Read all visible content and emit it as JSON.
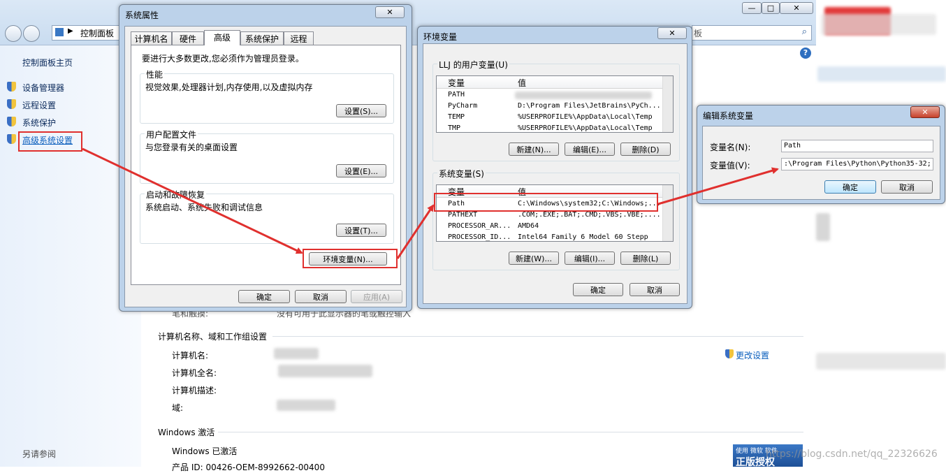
{
  "control_panel": {
    "breadcrumb": "控制面板",
    "breadcrumb_right": "板",
    "sidebar": {
      "home": "控制面板主页",
      "items": [
        "设备管理器",
        "远程设置",
        "系统保护",
        "高级系统设置"
      ],
      "see_also": "另请参阅"
    },
    "pen_touch_label": "笔和触摸:",
    "pen_touch_value": "没有可用于此显示器的笔或触控输入",
    "computer_section": "计算机名称、域和工作组设置",
    "rows": [
      "计算机名:",
      "计算机全名:",
      "计算机描述:",
      "域:"
    ],
    "change_settings": "更改设置",
    "windows_section": "Windows 激活",
    "activated": "Windows 已激活",
    "product_id": "产品 ID: 00426-OEM-8992662-00400",
    "badge_top": "使用 微软 软件",
    "badge_main": "正版授权",
    "watermark": "https://blog.csdn.net/qq_22326626"
  },
  "sys_props": {
    "title": "系统属性",
    "tabs": [
      "计算机名",
      "硬件",
      "高级",
      "系统保护",
      "远程"
    ],
    "admin_note": "要进行大多数更改,您必须作为管理员登录。",
    "perf_label": "性能",
    "perf_desc": "视觉效果,处理器计划,内存使用,以及虚拟内存",
    "perf_btn": "设置(S)...",
    "profile_label": "用户配置文件",
    "profile_desc": "与您登录有关的桌面设置",
    "profile_btn": "设置(E)...",
    "startup_label": "启动和故障恢复",
    "startup_desc": "系统启动、系统失败和调试信息",
    "startup_btn": "设置(T)...",
    "env_btn": "环境变量(N)...",
    "ok": "确定",
    "cancel": "取消",
    "apply": "应用(A)"
  },
  "env_vars": {
    "title": "环境变量",
    "user_group": "LLJ 的用户变量(U)",
    "col_var": "变量",
    "col_val": "值",
    "user_rows": [
      {
        "name": "PATH",
        "value": ""
      },
      {
        "name": "PyCharm",
        "value": "D:\\Program Files\\JetBrains\\PyCh..."
      },
      {
        "name": "TEMP",
        "value": "%USERPROFILE%\\AppData\\Local\\Temp"
      },
      {
        "name": "TMP",
        "value": "%USERPROFILE%\\AppData\\Local\\Temp"
      }
    ],
    "user_new": "新建(N)...",
    "user_edit": "编辑(E)...",
    "user_delete": "删除(D)",
    "sys_group": "系统变量(S)",
    "sys_rows": [
      {
        "name": "Path",
        "value": "C:\\Windows\\system32;C:\\Windows;..."
      },
      {
        "name": "PATHEXT",
        "value": ".COM;.EXE;.BAT;.CMD;.VBS;.VBE;...."
      },
      {
        "name": "PROCESSOR_AR...",
        "value": "AMD64"
      },
      {
        "name": "PROCESSOR_ID...",
        "value": "Intel64 Family 6 Model 60 Stepp"
      }
    ],
    "sys_new": "新建(W)...",
    "sys_edit": "编辑(I)...",
    "sys_delete": "删除(L)",
    "ok": "确定",
    "cancel": "取消"
  },
  "edit_var": {
    "title": "编辑系统变量",
    "name_label": "变量名(N):",
    "name_value": "Path",
    "value_label": "变量值(V):",
    "value_value": ":\\Program Files\\Python\\Python35-32;",
    "ok": "确定",
    "cancel": "取消"
  },
  "colors": {
    "annotation_red": "#e0302e",
    "link_blue": "#0b5fbd"
  }
}
